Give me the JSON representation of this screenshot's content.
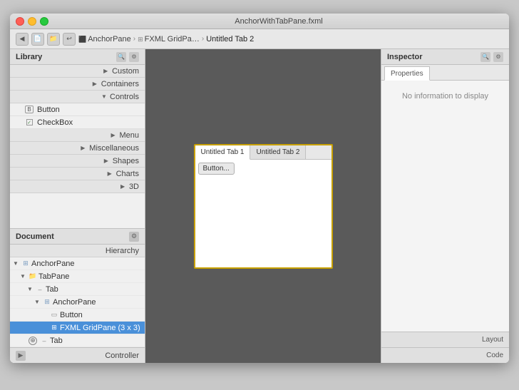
{
  "window": {
    "title": "AnchorWithTabPane.fxml"
  },
  "toolbar": {
    "breadcrumb": [
      "AnchorPane",
      "FXML GridPa…",
      "Untitled Tab 2"
    ]
  },
  "library": {
    "title": "Library",
    "sections": [
      {
        "id": "custom",
        "label": "Custom",
        "type": "section"
      },
      {
        "id": "containers",
        "label": "Containers",
        "type": "section"
      },
      {
        "id": "controls",
        "label": "Controls",
        "type": "section"
      },
      {
        "id": "button",
        "label": "Button",
        "type": "item",
        "icon": "btn"
      },
      {
        "id": "checkbox",
        "label": "CheckBox",
        "type": "item",
        "icon": "chk"
      },
      {
        "id": "menu",
        "label": "Menu",
        "type": "section"
      },
      {
        "id": "miscellaneous",
        "label": "Miscellaneous",
        "type": "section"
      },
      {
        "id": "shapes",
        "label": "Shapes",
        "type": "section"
      },
      {
        "id": "charts",
        "label": "Charts",
        "type": "section"
      },
      {
        "id": "3d",
        "label": "3D",
        "type": "section"
      }
    ]
  },
  "hierarchy": {
    "title": "Document",
    "items": [
      {
        "id": "h-hierarchy",
        "label": "Hierarchy",
        "depth": 0,
        "type": "section"
      },
      {
        "id": "h-anchorpane-root",
        "label": "AnchorPane",
        "depth": 0,
        "hasArrow": true,
        "open": true,
        "iconType": "anchor"
      },
      {
        "id": "h-tabpane",
        "label": "TabPane",
        "depth": 1,
        "hasArrow": true,
        "open": true,
        "iconType": "folder"
      },
      {
        "id": "h-tab1",
        "label": "Tab",
        "depth": 2,
        "hasArrow": true,
        "open": true,
        "iconType": "tab"
      },
      {
        "id": "h-anchorpane2",
        "label": "AnchorPane",
        "depth": 3,
        "hasArrow": true,
        "open": true,
        "iconType": "anchor",
        "selected": false
      },
      {
        "id": "h-button",
        "label": "Button",
        "depth": 4,
        "iconType": "btn"
      },
      {
        "id": "h-fxml-grid",
        "label": "FXML GridPane (3 x 3)",
        "depth": 4,
        "iconType": "grid",
        "selected": true
      },
      {
        "id": "h-tab2",
        "label": "Tab",
        "depth": 2,
        "hasAdd": true,
        "iconType": "tab"
      }
    ]
  },
  "canvas": {
    "tab1Label": "Untitled Tab 1",
    "tab2Label": "Untitled Tab 2",
    "buttonLabel": "Button..."
  },
  "inspector": {
    "title": "Inspector",
    "noInfoText": "No information to display",
    "tabs": {
      "properties": "Properties",
      "layout": "Layout",
      "code": "Code"
    }
  }
}
